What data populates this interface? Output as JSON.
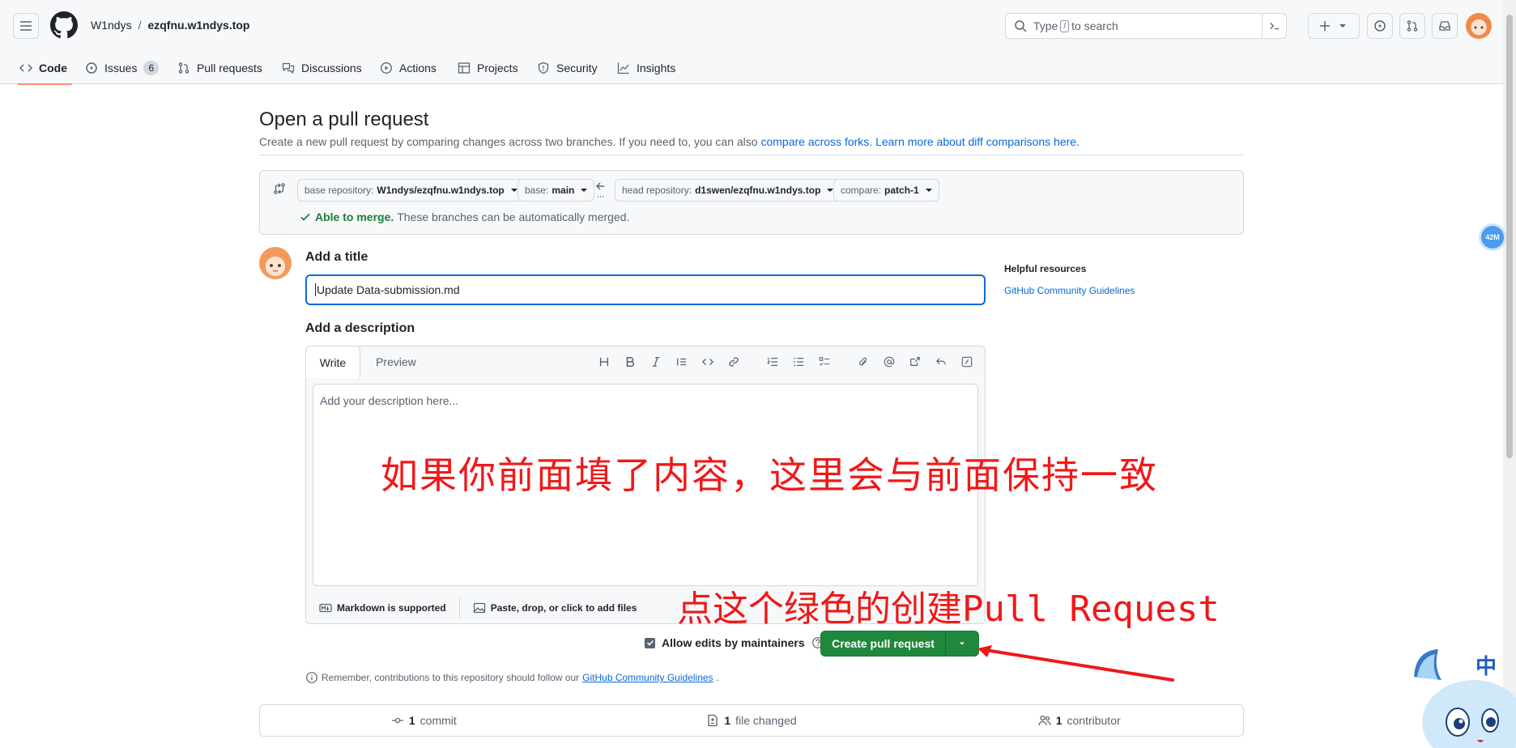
{
  "header": {
    "owner": "W1ndys",
    "separator": "/",
    "repo": "ezqfnu.w1ndys.top",
    "search_before": "Type",
    "search_key": "/",
    "search_after": "to search"
  },
  "nav": {
    "tabs": [
      {
        "label": "Code"
      },
      {
        "label": "Issues",
        "count": "6"
      },
      {
        "label": "Pull requests"
      },
      {
        "label": "Discussions"
      },
      {
        "label": "Actions"
      },
      {
        "label": "Projects"
      },
      {
        "label": "Security"
      },
      {
        "label": "Insights"
      }
    ]
  },
  "page": {
    "title": "Open a pull request",
    "subtitle": "Create a new pull request by comparing changes across two branches. If you need to, you can also ",
    "link1": "compare across forks.",
    "link2": "Learn more about diff comparisons here."
  },
  "range": {
    "base_repo_label": "base repository:",
    "base_repo": "W1ndys/ezqfnu.w1ndys.top",
    "base_label": "base:",
    "base": "main",
    "head_repo_label": "head repository:",
    "head_repo": "d1swen/ezqfnu.w1ndys.top",
    "compare_label": "compare:",
    "compare": "patch-1",
    "merge_status": "Able to merge.",
    "merge_detail": "These branches can be automatically merged."
  },
  "form": {
    "title_label": "Add a title",
    "title_value": "Update Data-submission.md",
    "description_label": "Add a description",
    "tab_write": "Write",
    "tab_preview": "Preview",
    "placeholder": "Add your description here...",
    "markdown_note": "Markdown is supported",
    "attach_note": "Paste, drop, or click to add files",
    "allow_edits": "Allow edits by maintainers",
    "create_button": "Create pull request",
    "reminder_prefix": "Remember, contributions to this repository should follow our ",
    "reminder_link": "GitHub Community Guidelines",
    "reminder_suffix": "."
  },
  "sidebar": {
    "heading": "Helpful resources",
    "link": "GitHub Community Guidelines"
  },
  "stats": {
    "commits_n": "1",
    "commits_label": "commit",
    "files_n": "1",
    "files_label": "file changed",
    "contributors_n": "1",
    "contributors_label": "contributor"
  },
  "annotations": {
    "note1": "如果你前面填了内容，这里会与前面保持一致",
    "note2": "点这个绿色的创建Pull Request"
  },
  "overlay": {
    "badge": "42M",
    "mascot_char": "中"
  },
  "colors": {
    "accent": "#0969da",
    "create": "#1f883d",
    "annotation": "#f01818",
    "success": "#1a7f37"
  }
}
